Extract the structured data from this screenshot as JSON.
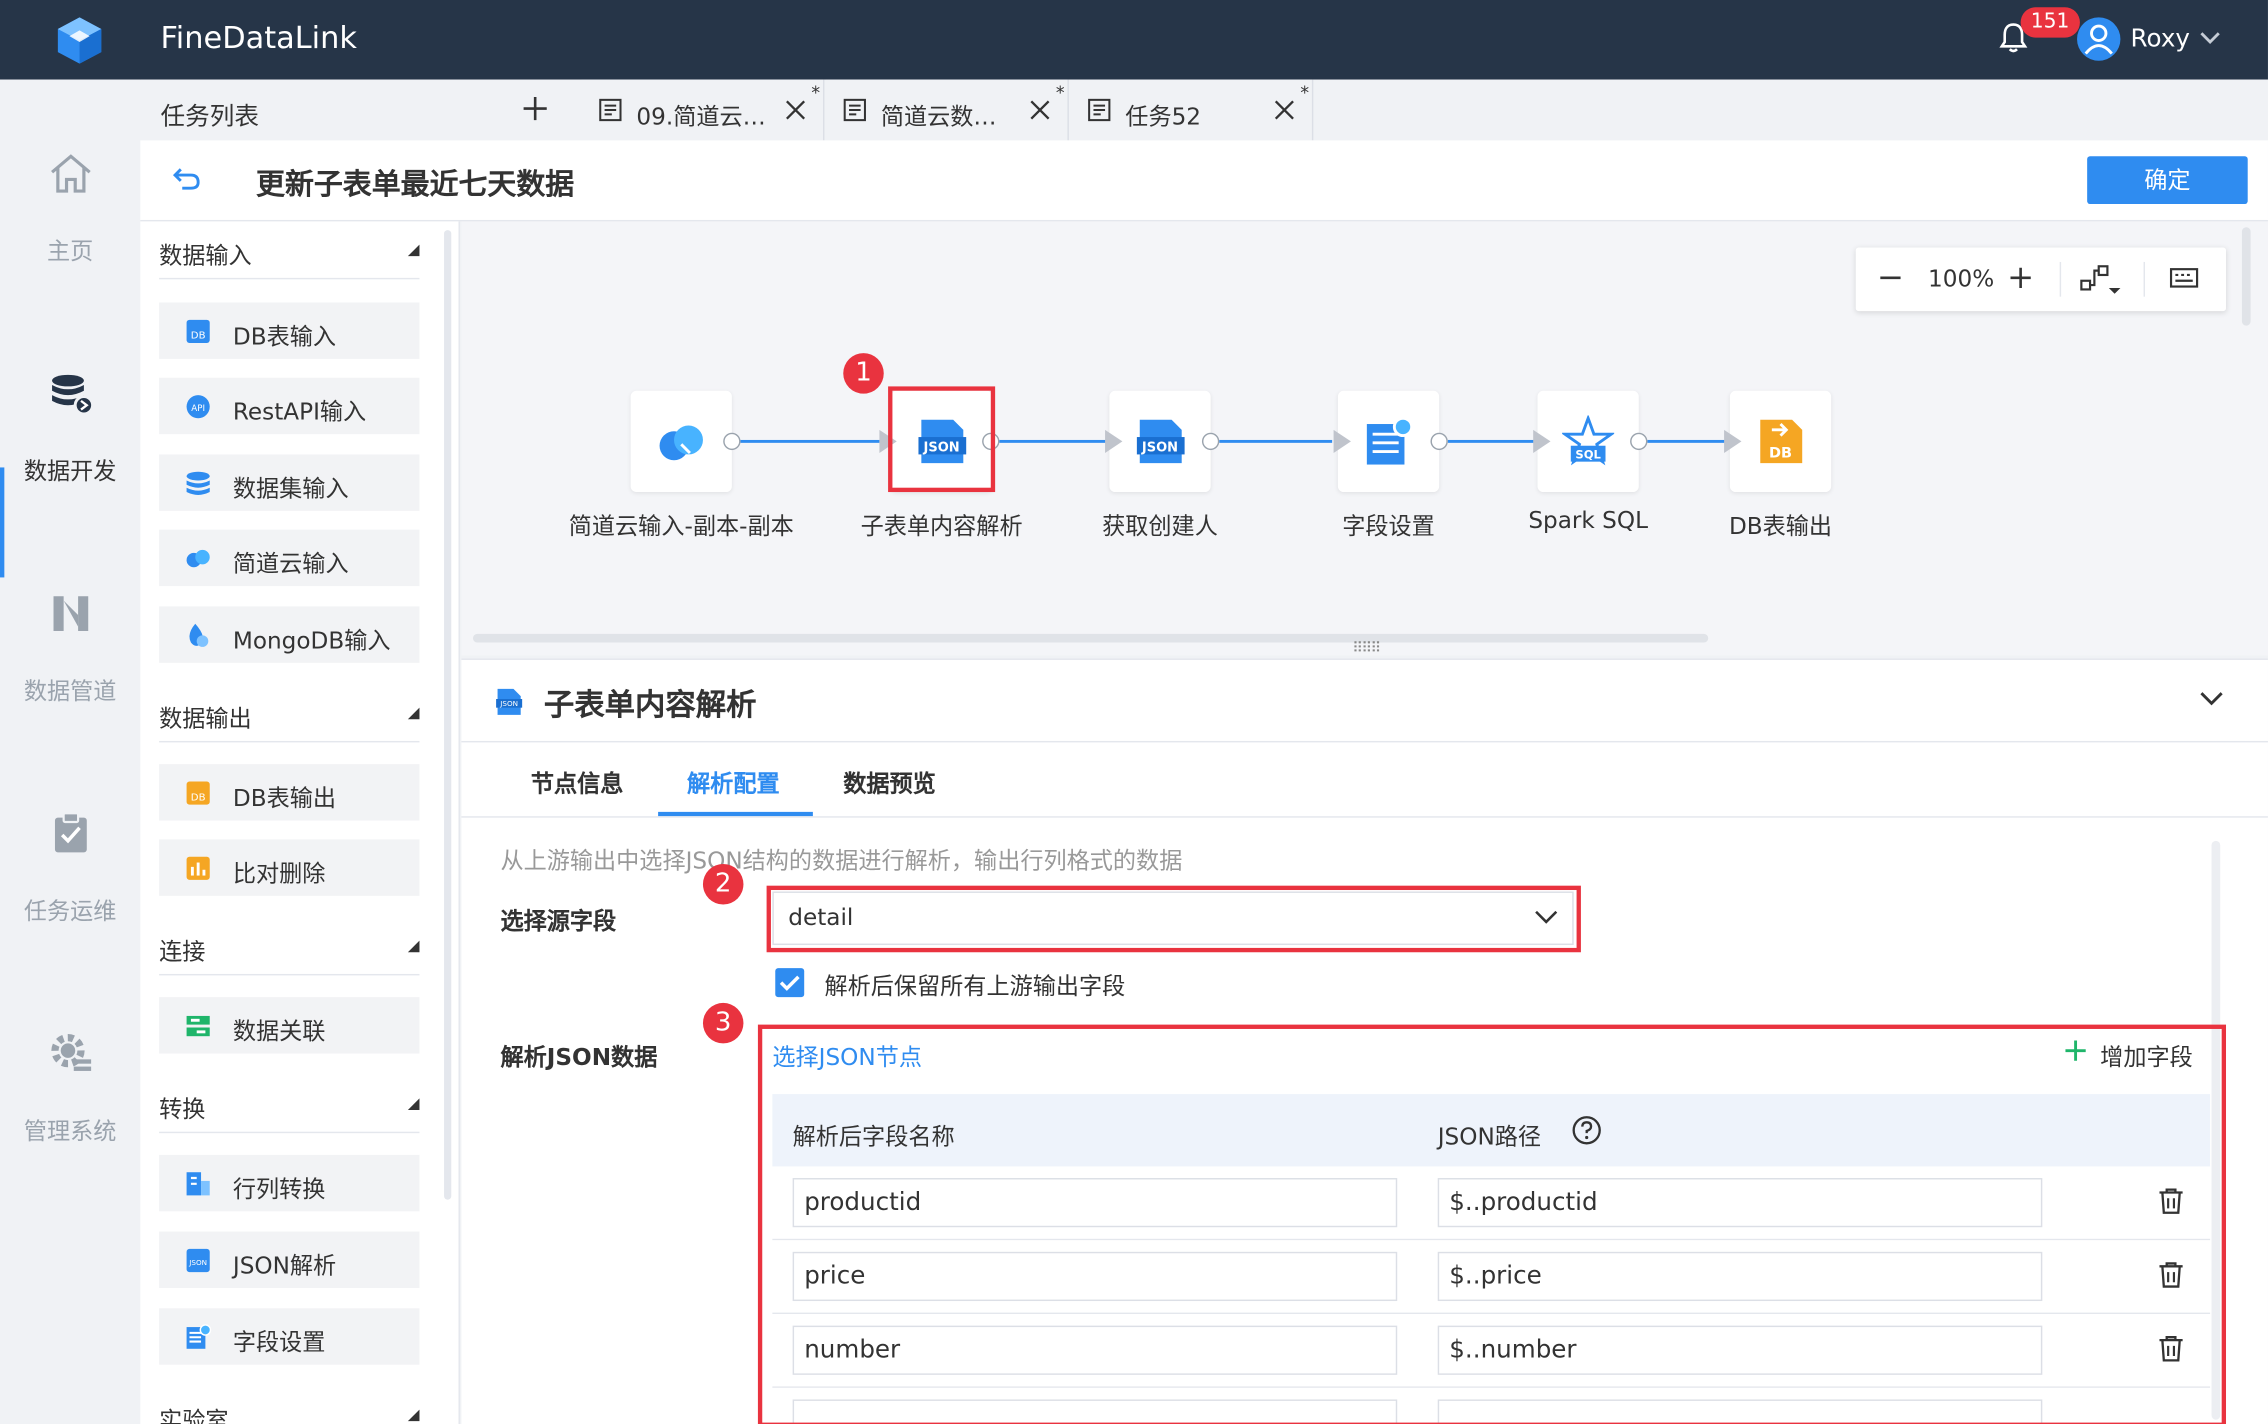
{
  "app": {
    "title": "FineDataLink",
    "notifications": "151",
    "user": "Roxy"
  },
  "left_nav": [
    {
      "label": "主页",
      "icon": "home-icon"
    },
    {
      "label": "数据开发",
      "icon": "database-icon",
      "active": true
    },
    {
      "label": "数据管道",
      "icon": "pipeline-icon"
    },
    {
      "label": "任务运维",
      "icon": "task-check-icon"
    },
    {
      "label": "管理系统",
      "icon": "gear-icon"
    }
  ],
  "tasklist": {
    "label": "任务列表"
  },
  "tabs": [
    {
      "label": "09.简道云…",
      "modified": "*"
    },
    {
      "label": "简道云数…",
      "modified": "*"
    },
    {
      "label": "任务52",
      "modified": "*"
    }
  ],
  "header": {
    "title": "更新子表单最近七天数据",
    "confirm": "确定"
  },
  "components": {
    "input": {
      "label": "数据输入",
      "items": [
        "DB表输入",
        "RestAPI输入",
        "数据集输入",
        "简道云输入",
        "MongoDB输入"
      ]
    },
    "output": {
      "label": "数据输出",
      "items": [
        "DB表输出",
        "比对删除"
      ]
    },
    "connect": {
      "label": "连接",
      "items": [
        "数据关联"
      ]
    },
    "transform": {
      "label": "转换",
      "items": [
        "行列转换",
        "JSON解析",
        "字段设置"
      ]
    },
    "lab": {
      "label": "实验室"
    }
  },
  "canvas": {
    "zoom": "100%",
    "nodes": [
      "简道云输入-副本-副本",
      "子表单内容解析",
      "获取创建人",
      "字段设置",
      "Spark SQL",
      "DB表输出"
    ]
  },
  "annotations": [
    "1",
    "2",
    "3"
  ],
  "config": {
    "title": "子表单内容解析",
    "tabs": [
      "节点信息",
      "解析配置",
      "数据预览"
    ],
    "active_tab": "解析配置",
    "description": "从上游输出中选择JSON结构的数据进行解析，输出行列格式的数据",
    "source_label": "选择源字段",
    "source_value": "detail",
    "keep_label": "解析后保留所有上游输出字段",
    "keep_checked": true,
    "json_label": "解析JSON数据",
    "select_node": "选择JSON节点",
    "add_field": "增加字段",
    "col_name": "解析后字段名称",
    "col_path": "JSON路径",
    "rows": [
      {
        "name": "productid",
        "path": "$..productid"
      },
      {
        "name": "price",
        "path": "$..price"
      },
      {
        "name": "number",
        "path": "$..number"
      }
    ]
  },
  "colors": {
    "accent": "#2f8cf0",
    "topbar": "#263548",
    "highlight": "#e9333f"
  }
}
